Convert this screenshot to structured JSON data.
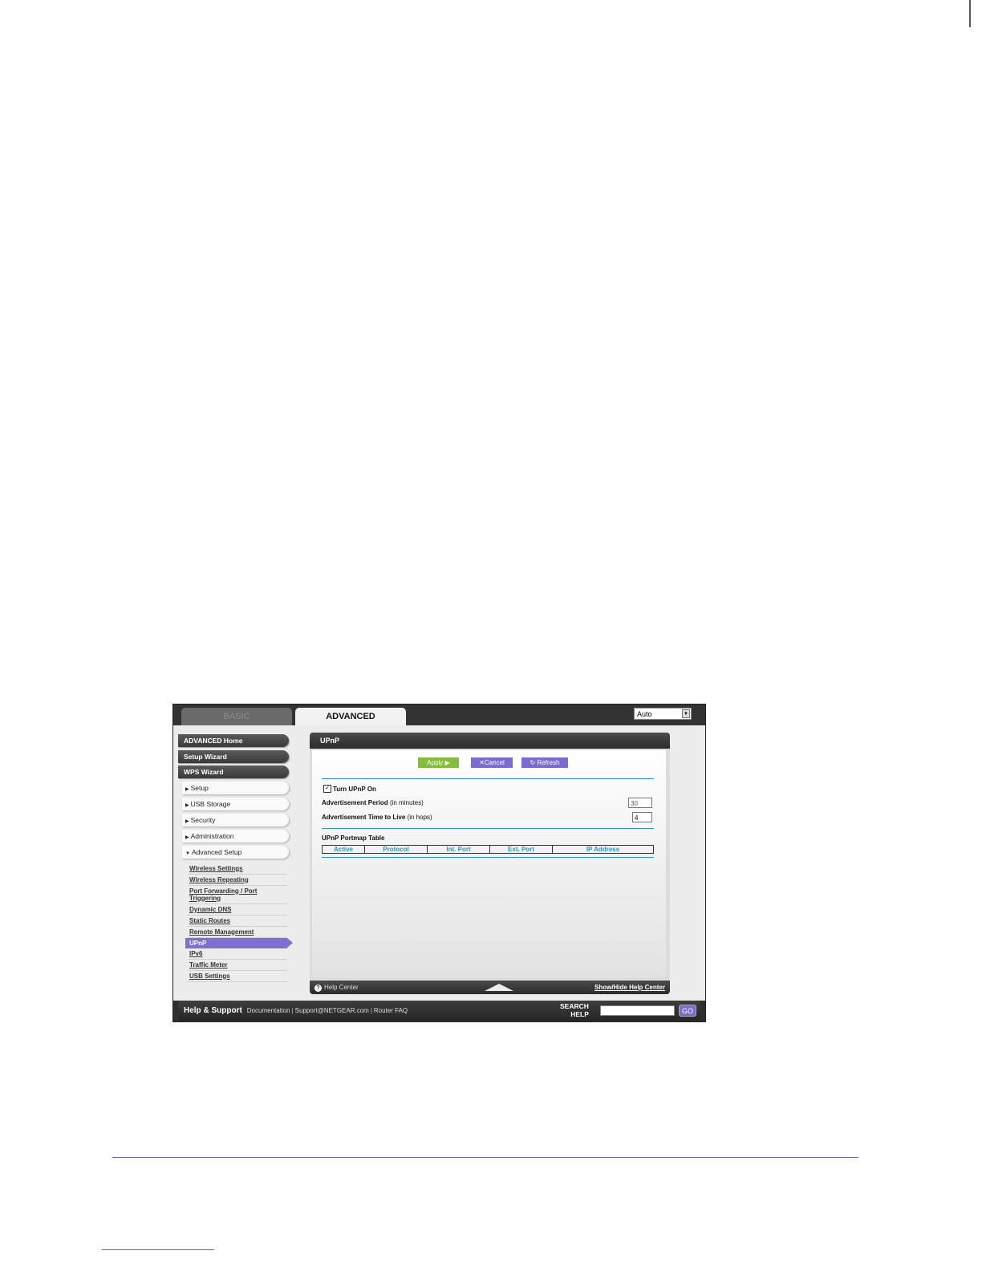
{
  "tabs": {
    "basic": "BASIC",
    "advanced": "ADVANCED"
  },
  "language": {
    "selected": "Auto"
  },
  "sidebar": {
    "main": [
      "ADVANCED Home",
      "Setup Wizard",
      "WPS Wizard"
    ],
    "sections": [
      "Setup",
      "USB Storage",
      "Security",
      "Administration"
    ],
    "advanced_setup": "Advanced Setup",
    "sub": [
      "Wireless Settings",
      "Wireless Repeating",
      "Port Forwarding / Port Triggering",
      "Dynamic DNS",
      "Static Routes",
      "Remote Management",
      "UPnP",
      "IPv6",
      "Traffic Meter",
      "USB Settings"
    ]
  },
  "panel": {
    "title": "UPnP",
    "apply": "Apply",
    "cancel": "Cancel",
    "refresh": "Refresh",
    "turn_on": "Turn UPnP On",
    "adv_period": "Advertisement Period",
    "adv_period_unit": "(in minutes)",
    "adv_period_value": "30",
    "adv_ttl": "Advertisement Time to Live",
    "adv_ttl_unit": "(in hops)",
    "adv_ttl_value": "4",
    "table_title": "UPnP Portmap Table",
    "columns": [
      "Active",
      "Protocol",
      "Int. Port",
      "Ext. Port",
      "IP Address"
    ],
    "help_center": "Help Center",
    "show_hide": "Show/Hide Help Center"
  },
  "footer": {
    "help_support": "Help & Support",
    "documentation": "Documentation",
    "support_email": "Support@NETGEAR.com",
    "router_faq": "Router FAQ",
    "search_1": "SEARCH",
    "search_2": "HELP",
    "go": "GO"
  }
}
